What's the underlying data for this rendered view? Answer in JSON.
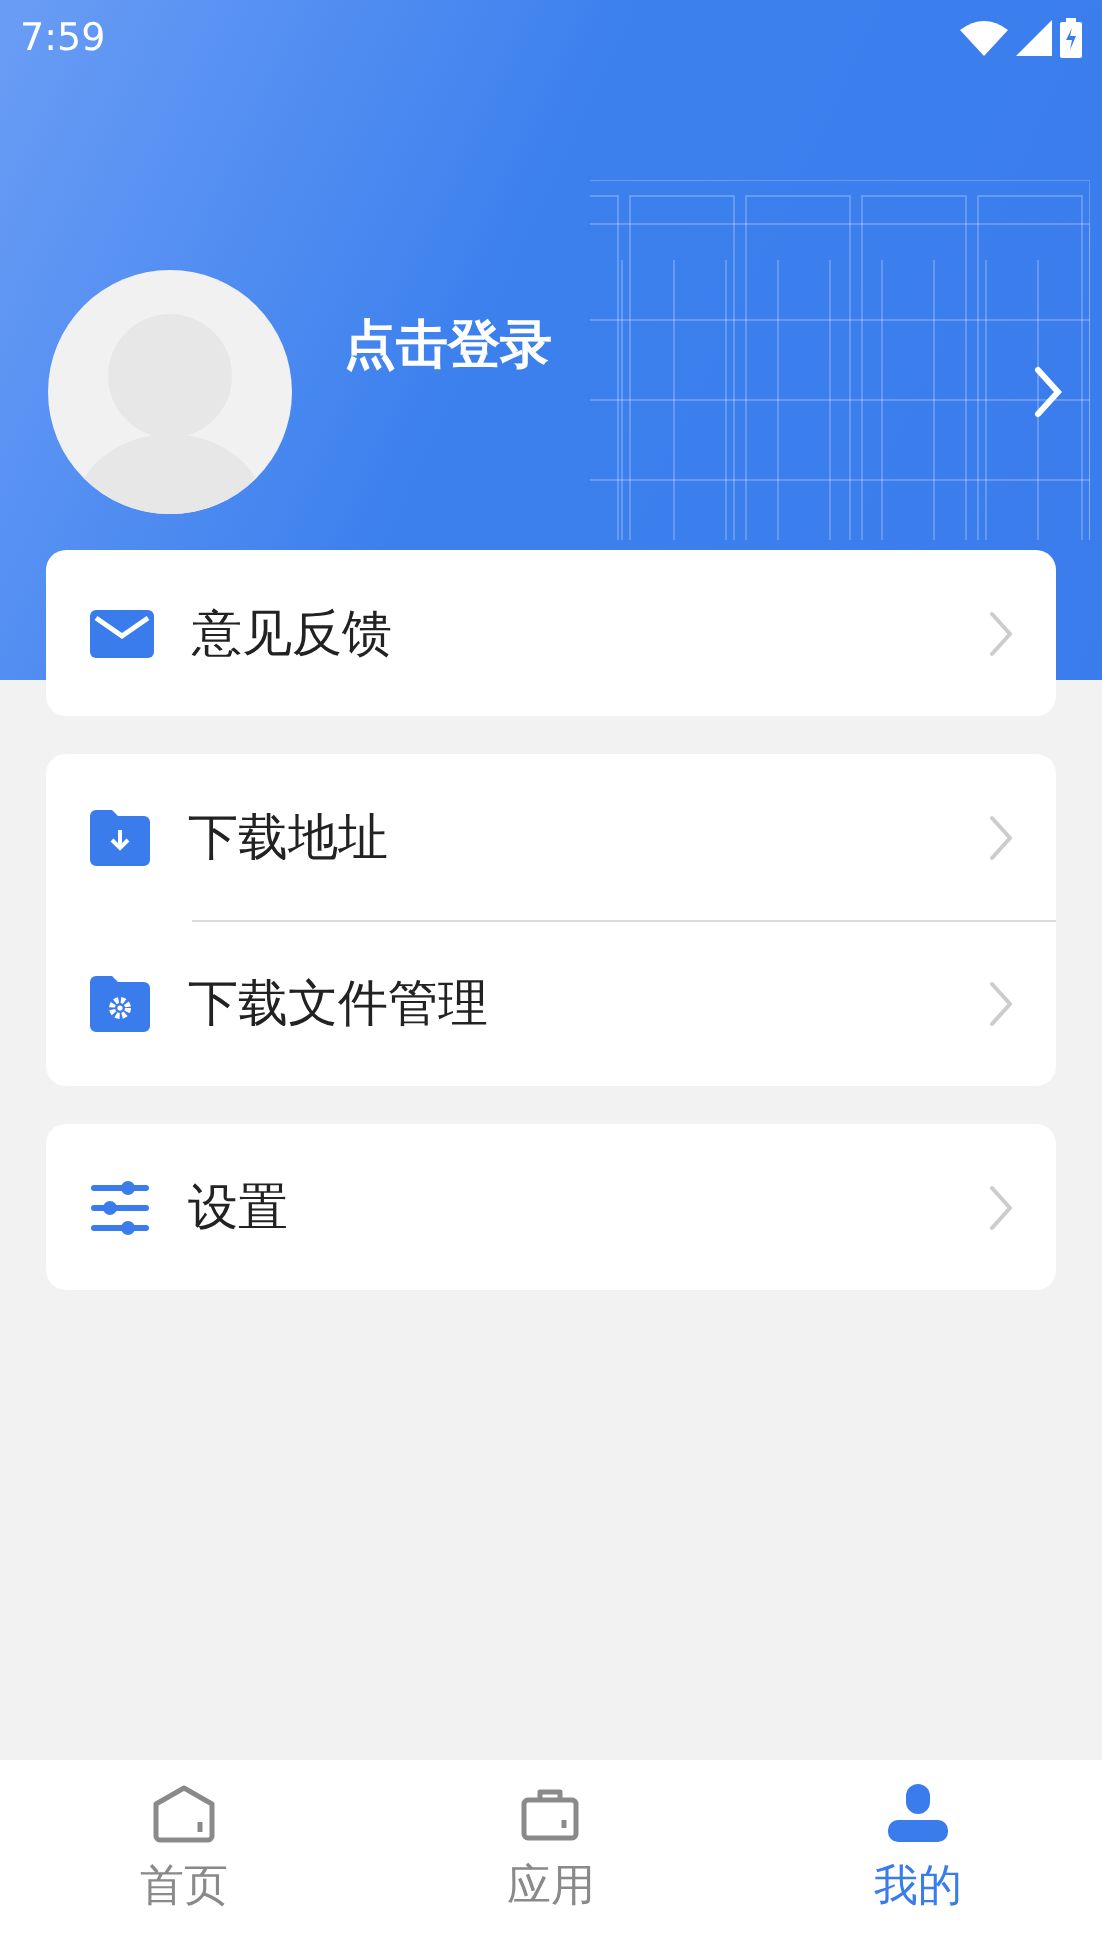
{
  "status_bar": {
    "time": "7:59"
  },
  "profile": {
    "login_label": "点击登录"
  },
  "menu_groups": [
    {
      "items": [
        {
          "kind": "mail",
          "label": "意见反馈"
        }
      ]
    },
    {
      "items": [
        {
          "kind": "download-folder",
          "label": "下载地址"
        },
        {
          "kind": "settings-folder",
          "label": "下载文件管理"
        }
      ]
    },
    {
      "items": [
        {
          "kind": "sliders",
          "label": "设置"
        }
      ]
    }
  ],
  "tabs": [
    {
      "kind": "home",
      "label": "首页",
      "selected": false
    },
    {
      "kind": "bag",
      "label": "应用",
      "selected": false
    },
    {
      "kind": "person",
      "label": "我的",
      "selected": true
    }
  ]
}
